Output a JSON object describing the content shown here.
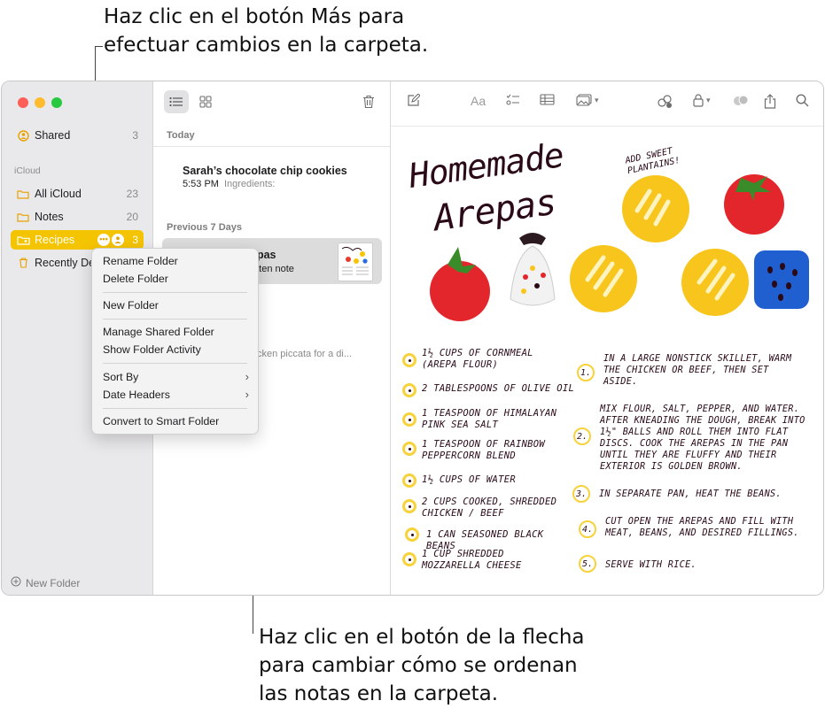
{
  "callouts": {
    "top_line1": "Haz clic en el botón Más para",
    "top_line2": "efectuar cambios en la carpeta.",
    "bottom_line1": "Haz clic en el botón de la flecha",
    "bottom_line2": "para cambiar cómo se ordenan",
    "bottom_line3": "las notas en la carpeta."
  },
  "sidebar": {
    "shared_label": "Shared",
    "shared_count": "3",
    "section": "iCloud",
    "items": [
      {
        "label": "All iCloud",
        "count": "23"
      },
      {
        "label": "Notes",
        "count": "20"
      },
      {
        "label": "Recipes",
        "count": "3"
      },
      {
        "label": "Recently De",
        "count": ""
      }
    ],
    "new_folder": "New Folder"
  },
  "notelist": {
    "today_header": "Today",
    "prev_header": "Previous 7 Days",
    "note1_title": "Sarah’s chocolate chip cookies",
    "note1_time": "5:53 PM",
    "note1_preview": "Ingredients:",
    "note2_title": "epas",
    "note2_preview": "ritten note",
    "note3_preview": "cken piccata for a di..."
  },
  "menu": {
    "rename": "Rename Folder",
    "delete": "Delete Folder",
    "new": "New Folder",
    "manage": "Manage Shared Folder",
    "activity": "Show Folder Activity",
    "sort": "Sort By",
    "date_headers": "Date Headers",
    "convert": "Convert to Smart Folder"
  },
  "note": {
    "title_line1": "Homemade",
    "title_line2": "Arepas",
    "aside": "ADD SWEET PLANTAINS!",
    "ingredients": [
      "1½ CUPS OF CORNMEAL (AREPA FLOUR)",
      "2 TABLESPOONS OF OLIVE OIL",
      "1 TEASPOON OF HIMALAYAN PINK SEA SALT",
      "1 TEASPOON OF RAINBOW PEPPERCORN BLEND",
      "1½ CUPS OF WATER",
      "2 CUPS COOKED, SHREDDED CHICKEN / BEEF",
      "1 CAN SEASONED BLACK BEANS",
      "1 CUP SHREDDED MOZZARELLA CHEESE"
    ],
    "steps": [
      {
        "num": "1.",
        "text": "IN A LARGE NONSTICK SKILLET, WARM THE CHICKEN OR BEEF, THEN SET ASIDE."
      },
      {
        "num": "2.",
        "text": "MIX FLOUR, SALT, PEPPER, AND WATER. AFTER KNEADING THE DOUGH, BREAK INTO 1½\" BALLS AND ROLL THEM INTO FLAT DISCS. COOK THE AREPAS IN THE PAN UNTIL THEY ARE FLUFFY AND THEIR EXTERIOR IS GOLDEN BROWN."
      },
      {
        "num": "3.",
        "text": "IN SEPARATE PAN, HEAT THE BEANS."
      },
      {
        "num": "4.",
        "text": "CUT OPEN THE AREPAS AND FILL WITH MEAT, BEANS, AND DESIRED FILLINGS."
      },
      {
        "num": "5.",
        "text": "SERVE WITH RICE."
      }
    ]
  },
  "colors": {
    "accent": "#f5c400",
    "ink": "#2b0a18"
  }
}
